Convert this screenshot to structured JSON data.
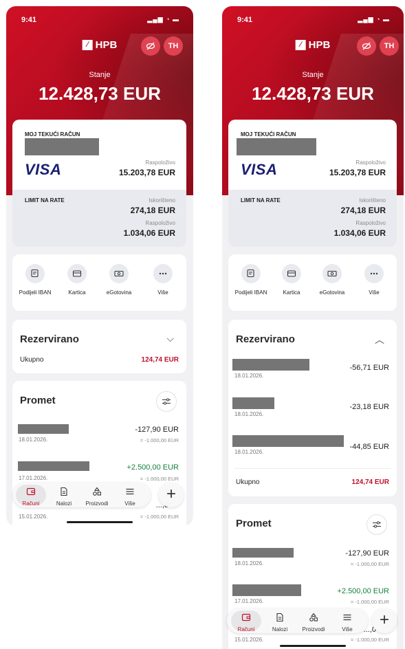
{
  "status": {
    "time": "9:41",
    "icons": "▂▄▆ ◔ ▬"
  },
  "header": {
    "logo_mark": "⁄",
    "logo_text": "HPB",
    "hide_icon": "eye-off-icon",
    "avatar": "TH"
  },
  "balance": {
    "label": "Stanje",
    "value": "12.428,73 EUR"
  },
  "account": {
    "name": "MOJ TEKUĆI RAČUN",
    "card_brand": "VISA",
    "available_label": "Raspoloživo",
    "available_value": "15.203,78 EUR",
    "limit_title": "LIMIT NA RATE",
    "used_label": "Iskorišteno",
    "used_value": "274,18 EUR",
    "limit_available_label": "Raspoloživo",
    "limit_available_value": "1.034,06 EUR"
  },
  "quick_actions": [
    {
      "label": "Podijeli IBAN",
      "icon": "share-iban-icon"
    },
    {
      "label": "Kartica",
      "icon": "card-icon"
    },
    {
      "label": "eGotovina",
      "icon": "cash-icon"
    },
    {
      "label": "Više",
      "icon": "more-icon"
    }
  ],
  "reserved": {
    "title": "Rezervirano",
    "total_label": "Ukupno",
    "total_value": "124,74 EUR",
    "items": [
      {
        "date": "18.01.2026.",
        "amount": "-56,71 EUR"
      },
      {
        "date": "18.01.2026.",
        "amount": "-23,18 EUR"
      },
      {
        "date": "18.01.2026.",
        "amount": "-44,85 EUR"
      }
    ]
  },
  "promet": {
    "title": "Promet",
    "transactions": [
      {
        "date": "18.01.2026.",
        "amount": "-127,90 EUR",
        "sub": "= -1.000,00 EUR",
        "positive": false
      },
      {
        "date": "17.01.2026.",
        "amount": "+2.500,00 EUR",
        "sub": "= -1.000,00 EUR",
        "positive": true
      },
      {
        "date": "15.01.2026.",
        "amount": "...,0",
        "sub": "= -1.000,00 EUR",
        "positive": false
      }
    ]
  },
  "nav": {
    "items": [
      {
        "label": "Računi",
        "icon": "wallet-icon",
        "active": true
      },
      {
        "label": "Nalozi",
        "icon": "document-icon",
        "active": false
      },
      {
        "label": "Proizvodi",
        "icon": "shapes-icon",
        "active": false
      },
      {
        "label": "Više",
        "icon": "menu-icon",
        "active": false
      }
    ],
    "plus": "+"
  },
  "colors": {
    "brand": "#c0102a",
    "positive": "#15803d"
  }
}
